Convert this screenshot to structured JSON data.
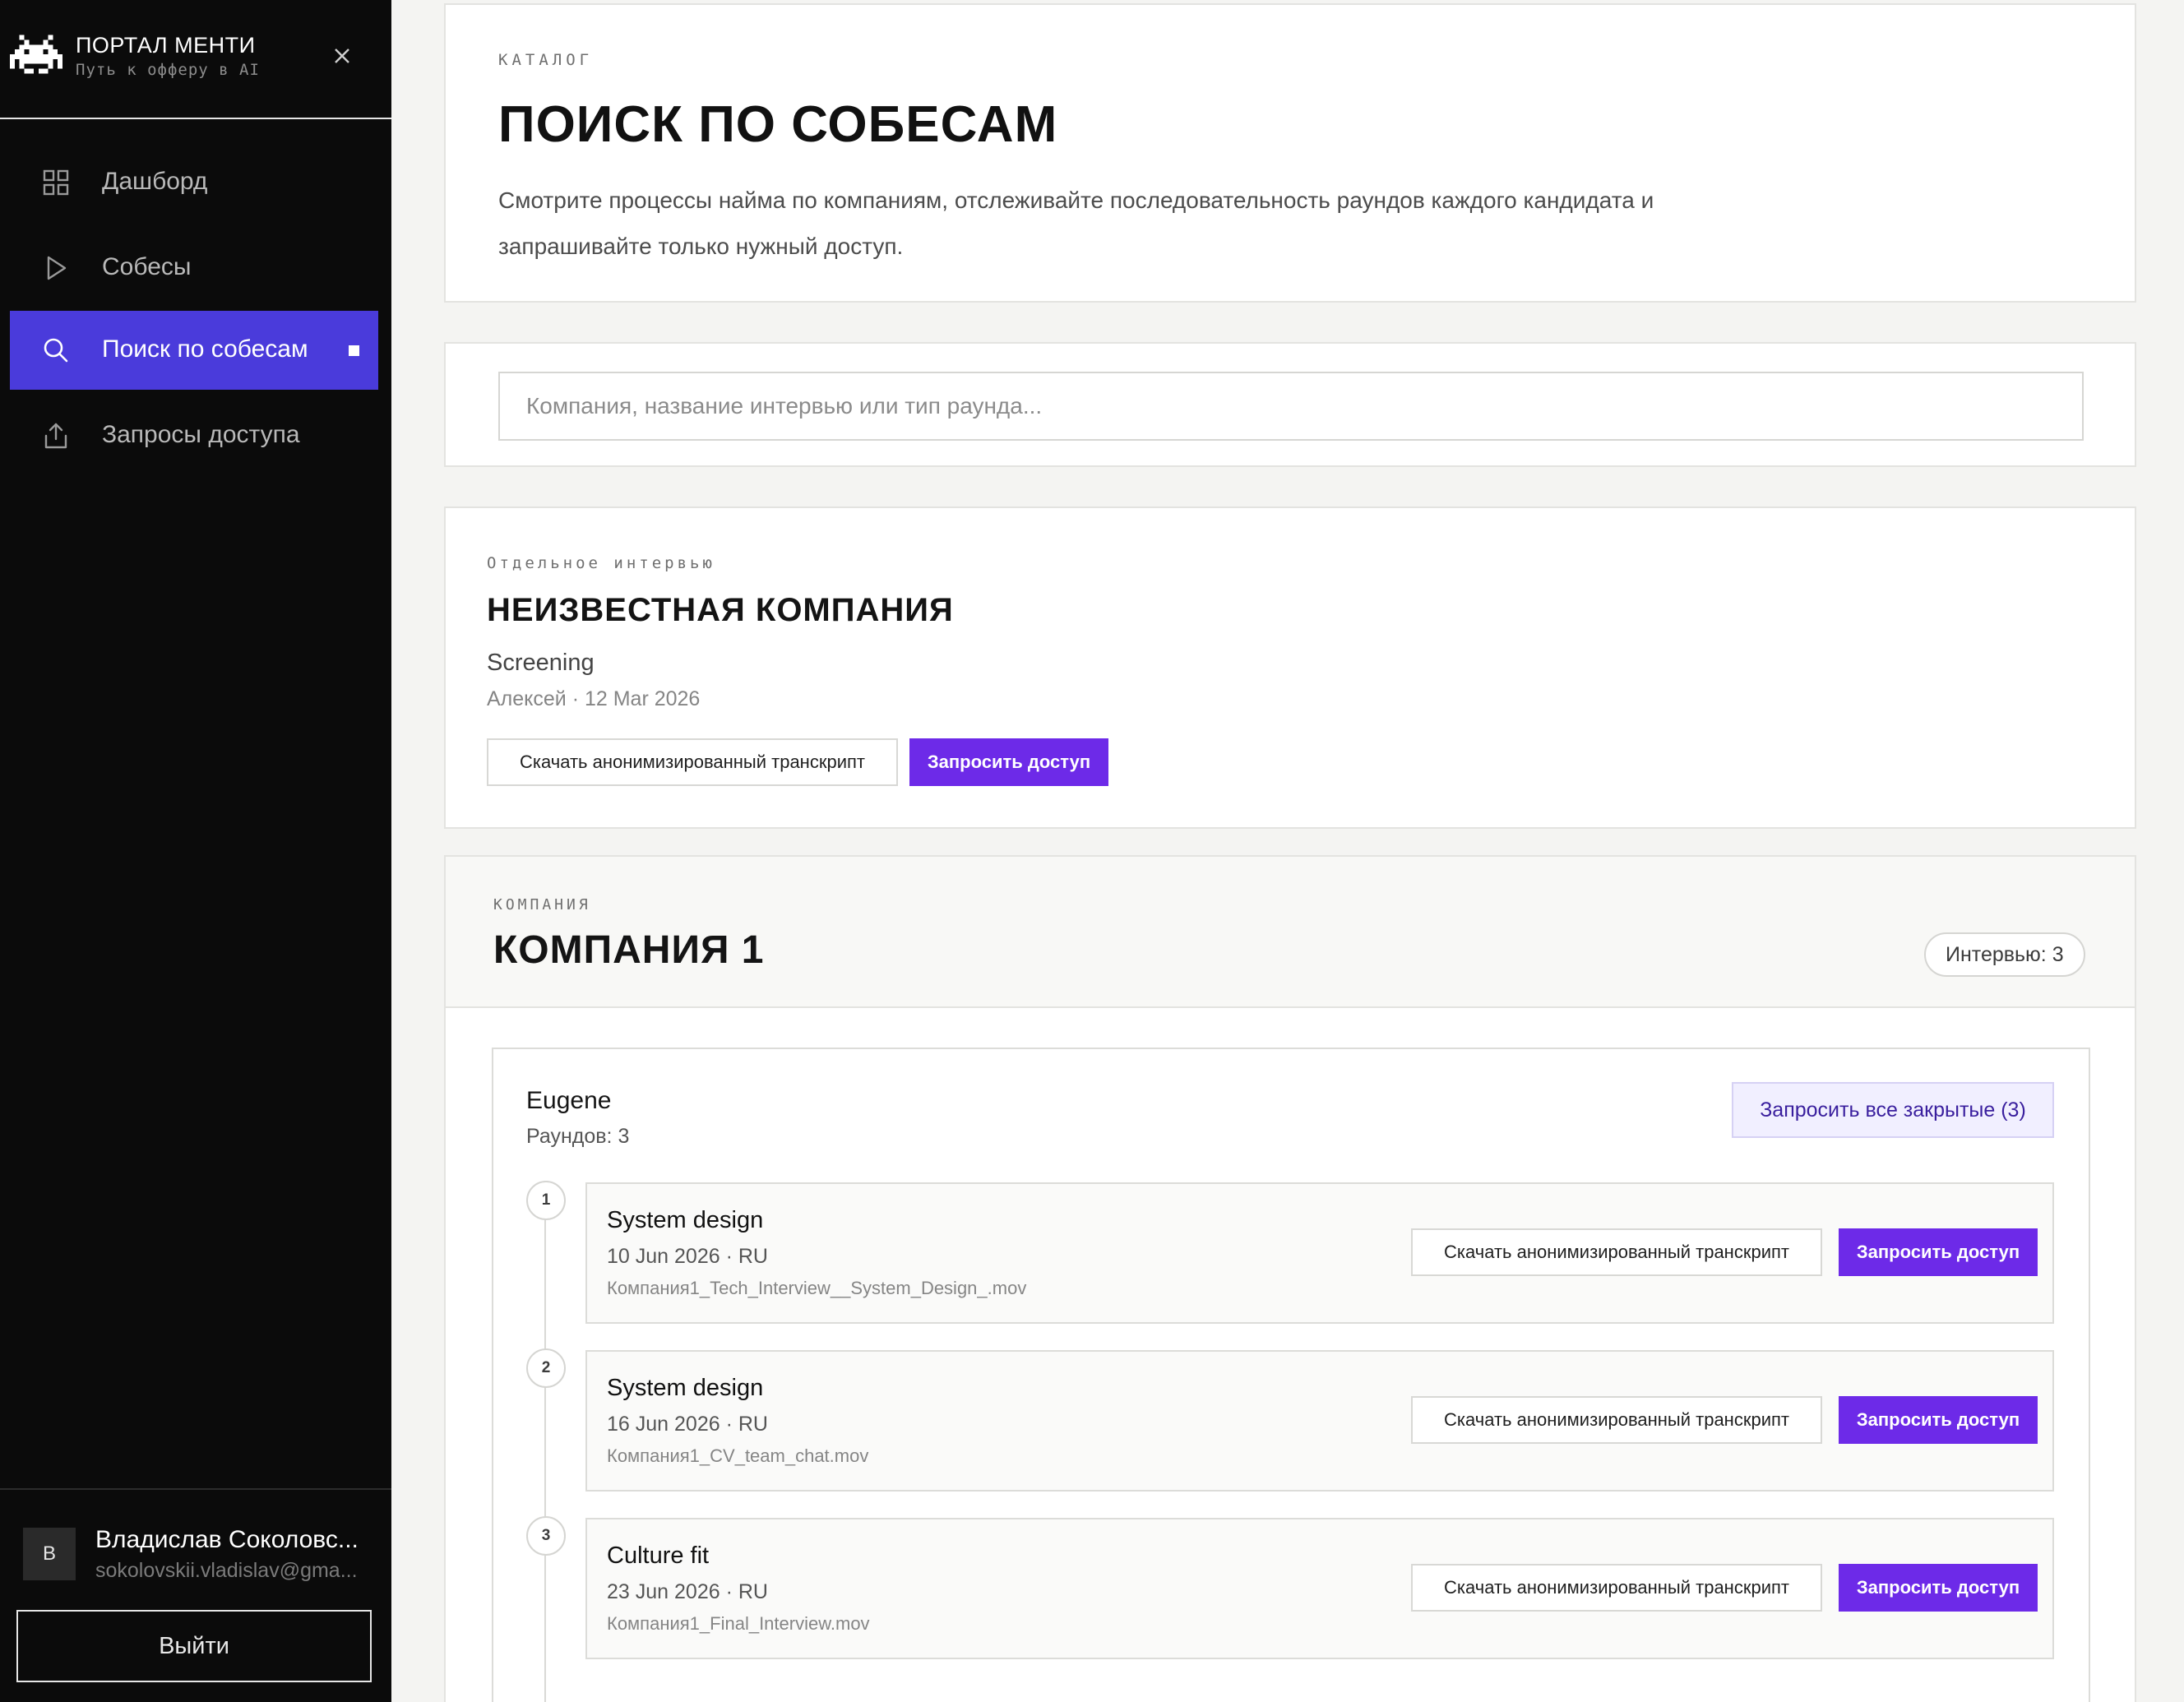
{
  "sidebar": {
    "brand_title": "ПОРТАЛ МЕНТИ",
    "brand_subtitle": "Путь к офферу в AI",
    "nav": [
      {
        "label": "Дашборд",
        "icon": "grid-icon",
        "active": false
      },
      {
        "label": "Собесы",
        "icon": "play-icon",
        "active": false
      },
      {
        "label": "Поиск по собесам",
        "icon": "search-icon",
        "active": true
      },
      {
        "label": "Запросы доступа",
        "icon": "upload-icon",
        "active": false
      }
    ],
    "user": {
      "initial": "В",
      "name": "Владислав Соколовс...",
      "email": "sokolovskii.vladislav@gma..."
    },
    "logout_label": "Выйти"
  },
  "hero": {
    "eyebrow": "КАТАЛОГ",
    "title": "ПОИСК ПО СОБЕСАМ",
    "description": "Смотрите процессы найма по компаниям, отслеживайте последовательность раундов каждого кандидата и запрашивайте только нужный доступ."
  },
  "search": {
    "placeholder": "Компания, название интервью или тип раунда...",
    "value": ""
  },
  "single_interview": {
    "eyebrow": "Отдельное интервью",
    "company": "НЕИЗВЕСТНАЯ КОМПАНИЯ",
    "round": "Screening",
    "meta": "Алексей · 12 Mar 2026",
    "download_label": "Скачать анонимизированный транскрипт",
    "request_label": "Запросить доступ"
  },
  "company": {
    "eyebrow": "КОМПАНИЯ",
    "title": "КОМПАНИЯ 1",
    "count_label": "Интервью: 3",
    "candidate": {
      "name": "Eugene",
      "rounds_label": "Раундов: 3",
      "request_all_label": "Запросить все закрытые (3)",
      "rounds": [
        {
          "num": "1",
          "title": "System design",
          "meta": "10 Jun 2026 · RU",
          "file": "Компания1_Tech_Interview__System_Design_.mov",
          "download_label": "Скачать анонимизированный транскрипт",
          "request_label": "Запросить доступ"
        },
        {
          "num": "2",
          "title": "System design",
          "meta": "16 Jun 2026 · RU",
          "file": "Компания1_CV_team_chat.mov",
          "download_label": "Скачать анонимизированный транскрипт",
          "request_label": "Запросить доступ"
        },
        {
          "num": "3",
          "title": "Culture fit",
          "meta": "23 Jun 2026 · RU",
          "file": "Компания1_Final_Interview.mov",
          "download_label": "Скачать анонимизированный транскрипт",
          "request_label": "Запросить доступ"
        }
      ]
    }
  },
  "colors": {
    "sidebar_bg": "#0b0b0b",
    "active_nav": "#4a3bdb",
    "primary_button": "#6d2ae8",
    "page_bg": "#f4f4f2"
  }
}
